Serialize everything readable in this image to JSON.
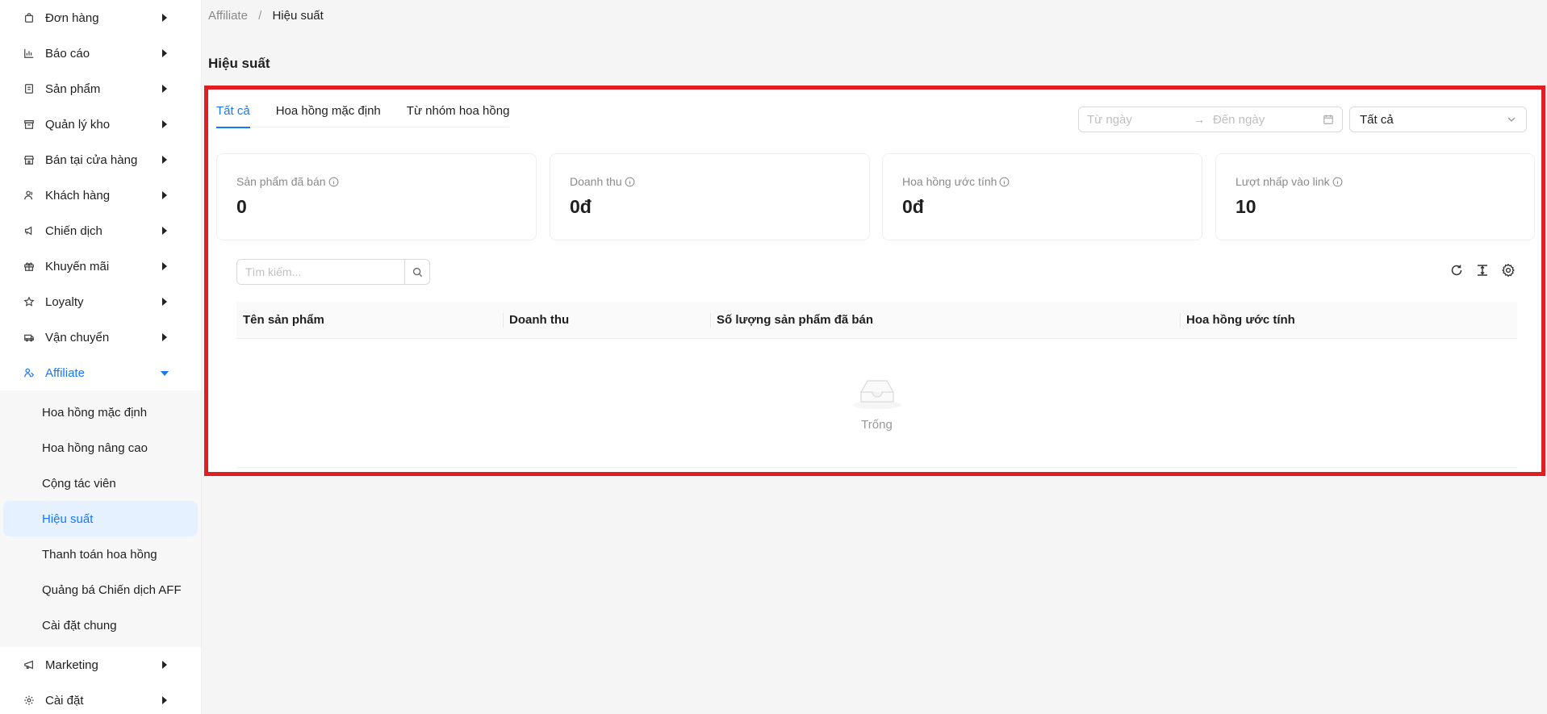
{
  "sidebar": {
    "items": [
      {
        "label": "Đơn hàng",
        "icon": "shopping-bag-icon"
      },
      {
        "label": "Báo cáo",
        "icon": "bar-chart-icon"
      },
      {
        "label": "Sản phẩm",
        "icon": "box-icon"
      },
      {
        "label": "Quản lý kho",
        "icon": "warehouse-icon"
      },
      {
        "label": "Bán tại cửa hàng",
        "icon": "store-icon"
      },
      {
        "label": "Khách hàng",
        "icon": "users-icon"
      },
      {
        "label": "Chiến dịch",
        "icon": "megaphone-icon"
      },
      {
        "label": "Khuyến mãi",
        "icon": "gift-icon"
      },
      {
        "label": "Loyalty",
        "icon": "star-icon"
      },
      {
        "label": "Vận chuyển",
        "icon": "truck-icon"
      },
      {
        "label": "Affiliate",
        "icon": "affiliate-icon"
      }
    ],
    "affiliate_sub": [
      "Hoa hồng mặc định",
      "Hoa hồng nâng cao",
      "Cộng tác viên",
      "Hiệu suất",
      "Thanh toán hoa hồng",
      "Quảng bá Chiến dịch AFF",
      "Cài đặt chung"
    ],
    "bottom_items": [
      {
        "label": "Marketing",
        "icon": "marketing-icon"
      },
      {
        "label": "Cài đặt",
        "icon": "gear-icon"
      }
    ]
  },
  "breadcrumb": {
    "parent": "Affiliate",
    "separator": "/",
    "current": "Hiệu suất"
  },
  "page_title": "Hiệu suất",
  "tabs": [
    "Tất cả",
    "Hoa hồng mặc định",
    "Từ nhóm hoa hồng"
  ],
  "filters": {
    "date_from_placeholder": "Từ ngày",
    "date_arrow": "→",
    "date_to_placeholder": "Đến ngày",
    "select_value": "Tất cả"
  },
  "stats": [
    {
      "label": "Sản phẩm đã bán",
      "value": "0"
    },
    {
      "label": "Doanh thu",
      "value": "0đ"
    },
    {
      "label": "Hoa hồng ước tính",
      "value": "0đ"
    },
    {
      "label": "Lượt nhấp vào link",
      "value": "10"
    }
  ],
  "search": {
    "placeholder": "Tìm kiếm...",
    "value": ""
  },
  "table": {
    "columns": [
      "Tên sản phẩm",
      "Doanh thu",
      "Số lượng sản phẩm đã bán",
      "Hoa hồng ước tính"
    ],
    "rows": [],
    "empty_text": "Trống"
  },
  "colors": {
    "accent": "#1677ff",
    "highlight_border": "#e11d23",
    "selected_bg": "#e6f1ff"
  }
}
